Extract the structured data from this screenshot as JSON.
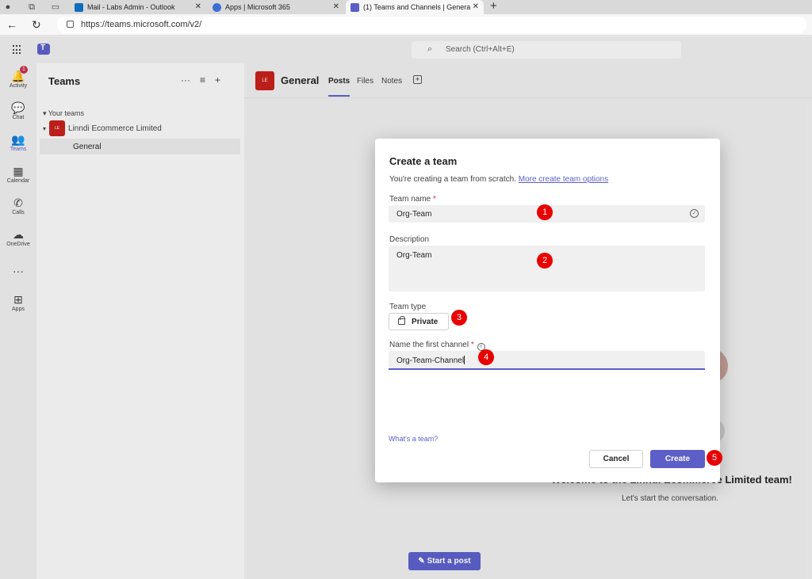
{
  "browser": {
    "tabs": [
      {
        "title": "Mail - Labs Admin - Outlook"
      },
      {
        "title": "Apps | Microsoft 365"
      },
      {
        "title": "(1) Teams and Channels | General"
      }
    ],
    "close_glyph": "✕",
    "new_tab_glyph": "+",
    "url": "https://teams.microsoft.com/v2/",
    "nav_icons": {
      "back": "arrow-left-icon",
      "refresh": "refresh-icon"
    }
  },
  "teams": {
    "search_placeholder": "Search (Ctrl+Alt+E)",
    "rail": [
      {
        "label": "Activity",
        "icon": "bell-icon",
        "glyph": "🔔",
        "badge": "1"
      },
      {
        "label": "Chat",
        "icon": "chat-icon",
        "glyph": "💬"
      },
      {
        "label": "Teams",
        "icon": "people-icon",
        "glyph": "👥"
      },
      {
        "label": "Calendar",
        "icon": "calendar-icon",
        "glyph": "▦"
      },
      {
        "label": "Calls",
        "icon": "phone-icon",
        "glyph": "✆"
      },
      {
        "label": "OneDrive",
        "icon": "cloud-icon",
        "glyph": "☁"
      },
      {
        "label": "",
        "icon": "more-icon",
        "glyph": "···"
      },
      {
        "label": "Apps",
        "icon": "apps-icon",
        "glyph": "⊞"
      }
    ],
    "panel": {
      "title": "Teams",
      "section": "Your teams",
      "team_name": "Linndi Ecommerce Limited",
      "team_initials": "LE",
      "channel": "General"
    },
    "channel_header": {
      "initials": "LE",
      "name": "General",
      "tabs": [
        "Posts",
        "Files",
        "Notes"
      ],
      "active_tab": "Posts"
    },
    "welcome": "Welcome to the Linndi Ecommerce Limited team!",
    "welcome_sub": "Let's start the conversation.",
    "start_post": "Start a post"
  },
  "dialog": {
    "title": "Create a team",
    "intro": "You're creating a team from scratch.",
    "intro_link": "More create team options",
    "team_name_label": "Team name",
    "team_name_value": "Org-Team",
    "description_label": "Description",
    "description_value": "Org-Team",
    "team_type_label": "Team type",
    "team_type_value": "Private",
    "channel_label": "Name the first channel",
    "channel_value": "Org-Team-Channel",
    "whats_team": "What's a team?",
    "cancel": "Cancel",
    "create": "Create"
  },
  "markers": [
    "1",
    "2",
    "3",
    "4",
    "5"
  ],
  "colors": {
    "accent": "#5b5fc7",
    "marker": "#e80000",
    "team_avatar": "#c4201c"
  }
}
